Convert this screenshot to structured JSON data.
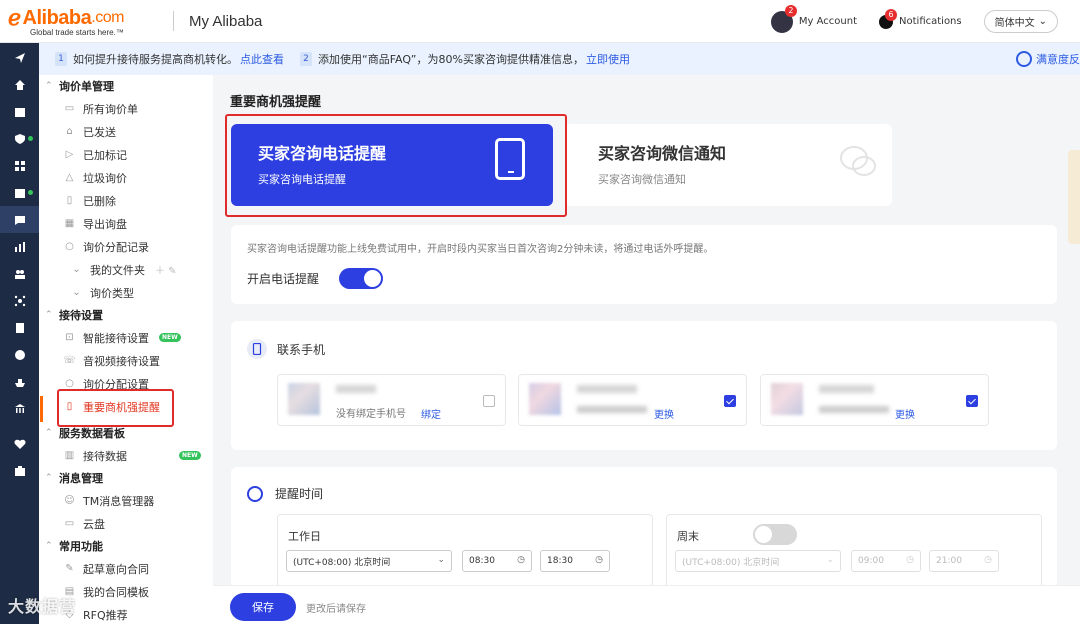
{
  "header": {
    "logo_text": "Alibaba",
    "logo_com": ".com",
    "logo_tagline": "Global trade starts here.™",
    "title": "My Alibaba",
    "account_label": "My Account",
    "account_badge": "2",
    "notifications_label": "Notifications",
    "notifications_badge": "6",
    "language": "简体中文"
  },
  "announcement": {
    "item1_num": "1",
    "item1_text": "如何提升接待服务提高商机转化。",
    "item1_link": "点此查看",
    "item2_num": "2",
    "item2_text": "添加使用“商品FAQ”，为80%买家咨询提供精准信息，",
    "item2_link": "立即使用",
    "right_link": "满意度反"
  },
  "sidebar": {
    "groups": {
      "inquiry": "询价单管理",
      "reception": "接待设置",
      "dashboard": "服务数据看板",
      "messages": "消息管理",
      "common": "常用功能"
    },
    "items": {
      "all_inquiries": "所有询价单",
      "sent": "已发送",
      "marked": "已加标记",
      "spam": "垃圾询价",
      "deleted": "已删除",
      "export": "导出询盘",
      "assign_records": "询价分配记录",
      "my_folders": "我的文件夹",
      "inquiry_types": "询价类型",
      "smart_reception": "智能接待设置",
      "av_reception": "音视频接待设置",
      "assign_settings": "询价分配设置",
      "important_alert": "重要商机强提醒",
      "reception_data": "接待数据",
      "tm_manager": "TM消息管理器",
      "cloud_disk": "云盘",
      "draft_contract": "起草意向合同",
      "contract_template": "我的合同模板",
      "rfq": "RFQ推荐"
    },
    "new_badge": "NEW"
  },
  "main": {
    "section_title": "重要商机强提醒",
    "card_phone": {
      "title": "买家咨询电话提醒",
      "subtitle": "买家咨询电话提醒"
    },
    "card_wechat": {
      "title": "买家咨询微信通知",
      "subtitle": "买家咨询微信通知"
    },
    "phone_desc": "买家咨询电话提醒功能上线免费试用中，开启时段内买家当日首次咨询2分钟未读，将通过电话外呼提醒。",
    "enable_label": "开启电话提醒",
    "enable_on": true,
    "contacts_title": "联系手机",
    "contacts": [
      {
        "phone_text": "没有绑定手机号",
        "link": "绑定",
        "checked": false
      },
      {
        "phone_text": "",
        "link": "更换",
        "checked": true
      },
      {
        "phone_text": "",
        "link": "更换",
        "checked": true
      }
    ],
    "time_title": "提醒时间",
    "workday": {
      "label": "工作日",
      "timezone": "(UTC+08:00) 北京时间",
      "start": "08:30",
      "end": "18:30"
    },
    "weekend": {
      "label": "周末",
      "enabled": false,
      "timezone": "(UTC+08:00) 北京时间",
      "start": "09:00",
      "end": "21:00"
    }
  },
  "footer": {
    "save_label": "保存",
    "save_hint": "更改后请保存"
  },
  "watermark": "大数据营"
}
